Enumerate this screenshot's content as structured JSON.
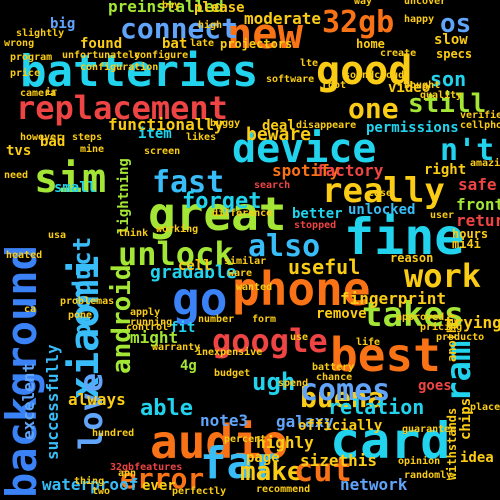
{
  "words": [
    {
      "text": "batteries",
      "color": "#22d3ee"
    },
    {
      "text": "new",
      "color": "#f97316"
    },
    {
      "text": "good",
      "color": "#facc15"
    },
    {
      "text": "32gb",
      "color": "#f97316"
    },
    {
      "text": "os",
      "color": "#60a5fa"
    },
    {
      "text": "replacement",
      "color": "#ef4444"
    },
    {
      "text": "device",
      "color": "#22d3ee"
    },
    {
      "text": "connect",
      "color": "#60a5fa"
    },
    {
      "text": "sim",
      "color": "#a3e635"
    },
    {
      "text": "fast",
      "color": "#38bdf8"
    },
    {
      "text": "n't",
      "color": "#22d3ee"
    },
    {
      "text": "one",
      "color": "#facc15"
    },
    {
      "text": "still",
      "color": "#a3e635"
    },
    {
      "text": "son",
      "color": "#22d3ee"
    },
    {
      "text": "great",
      "color": "#a3e635"
    },
    {
      "text": "really",
      "color": "#facc15"
    },
    {
      "text": "fine",
      "color": "#22d3ee"
    },
    {
      "text": "background",
      "color": "#3b82f6"
    },
    {
      "text": "xiaomi",
      "color": "#38bdf8"
    },
    {
      "text": "unlock",
      "color": "#a3e635"
    },
    {
      "text": "also",
      "color": "#38bdf8"
    },
    {
      "text": "work",
      "color": "#facc15"
    },
    {
      "text": "go",
      "color": "#3b82f6"
    },
    {
      "text": "phone",
      "color": "#f97316"
    },
    {
      "text": "google",
      "color": "#ef4444"
    },
    {
      "text": "takes",
      "color": "#a3e635"
    },
    {
      "text": "best",
      "color": "#f97316"
    },
    {
      "text": "buena",
      "color": "#facc15"
    },
    {
      "text": "android",
      "color": "#a3e635"
    },
    {
      "text": "ugh",
      "color": "#22d3ee"
    },
    {
      "text": "comes",
      "color": "#60a5fa"
    },
    {
      "text": "ram",
      "color": "#22d3ee"
    },
    {
      "text": "love",
      "color": "#60a5fa"
    },
    {
      "text": "audio",
      "color": "#f97316"
    },
    {
      "text": "card",
      "color": "#22d3ee"
    },
    {
      "text": "far",
      "color": "#38bdf8"
    },
    {
      "text": "error",
      "color": "#f97316"
    },
    {
      "text": "make",
      "color": "#facc15"
    },
    {
      "text": "cut",
      "color": "#f97316"
    },
    {
      "text": "product",
      "color": "#38bdf8"
    },
    {
      "text": "forget",
      "color": "#22d3ee"
    },
    {
      "text": "beware",
      "color": "#facc15"
    },
    {
      "text": "useful",
      "color": "#facc15"
    },
    {
      "text": "relation",
      "color": "#22d3ee"
    },
    {
      "text": "able",
      "color": "#22d3ee"
    },
    {
      "text": "note3",
      "color": "#60a5fa"
    },
    {
      "text": "galaxy",
      "color": "#60a5fa"
    },
    {
      "text": "highly",
      "color": "#facc15"
    },
    {
      "text": "sizethis",
      "color": "#facc15"
    },
    {
      "text": "network",
      "color": "#60a5fa"
    },
    {
      "text": "waterproof",
      "color": "#38bdf8"
    },
    {
      "text": "successfully",
      "color": "#38bdf8"
    },
    {
      "text": "excelent",
      "color": "#60a5fa"
    },
    {
      "text": "functionally",
      "color": "#facc15"
    },
    {
      "text": "preinstalled",
      "color": "#a3e635"
    },
    {
      "text": "spotify",
      "color": "#f97316"
    },
    {
      "text": "factory",
      "color": "#ef4444"
    },
    {
      "text": "gradable",
      "color": "#22d3ee"
    },
    {
      "text": "might",
      "color": "#a3e635"
    },
    {
      "text": "always",
      "color": "#facc15"
    },
    {
      "text": "safe",
      "color": "#ef4444"
    },
    {
      "text": "front",
      "color": "#a3e635"
    },
    {
      "text": "return",
      "color": "#ef4444"
    },
    {
      "text": "trying",
      "color": "#facc15"
    },
    {
      "text": "fingerprint",
      "color": "#facc15"
    },
    {
      "text": "remove",
      "color": "#facc15"
    },
    {
      "text": "goes",
      "color": "#ef4444"
    },
    {
      "text": "chips",
      "color": "#facc15"
    },
    {
      "text": "idea",
      "color": "#facc15"
    },
    {
      "text": "ever",
      "color": "#facc15"
    },
    {
      "text": "page",
      "color": "#facc15"
    },
    {
      "text": "officially",
      "color": "#facc15"
    },
    {
      "text": "moderate",
      "color": "#facc15"
    },
    {
      "text": "please",
      "color": "#facc15"
    },
    {
      "text": "slow",
      "color": "#facc15"
    },
    {
      "text": "video",
      "color": "#facc15"
    },
    {
      "text": "permissions",
      "color": "#22d3ee"
    },
    {
      "text": "deal",
      "color": "#facc15"
    },
    {
      "text": "better",
      "color": "#22d3ee"
    },
    {
      "text": "unlocked",
      "color": "#38bdf8"
    },
    {
      "text": "right",
      "color": "#facc15"
    },
    {
      "text": "small",
      "color": "#22d3ee"
    },
    {
      "text": "bad",
      "color": "#facc15"
    },
    {
      "text": "item",
      "color": "#22d3ee"
    },
    {
      "text": "lightning",
      "color": "#a3e635"
    },
    {
      "text": "cell",
      "color": "#facc15"
    },
    {
      "text": "fit",
      "color": "#22d3ee"
    },
    {
      "text": "4g",
      "color": "#a3e635"
    },
    {
      "text": "big",
      "color": "#60a5fa"
    },
    {
      "text": "found",
      "color": "#facc15"
    },
    {
      "text": "bat",
      "color": "#facc15"
    },
    {
      "text": "projectors",
      "color": "#facc15"
    },
    {
      "text": "home",
      "color": "#facc15"
    },
    {
      "text": "tvs",
      "color": "#facc15"
    },
    {
      "text": "uncover",
      "color": "#facc15"
    },
    {
      "text": "specs",
      "color": "#facc15"
    },
    {
      "text": "hours",
      "color": "#facc15"
    },
    {
      "text": "mi4i",
      "color": "#facc15"
    },
    {
      "text": "reason",
      "color": "#facc15"
    },
    {
      "text": "difference",
      "color": "#facc15"
    },
    {
      "text": "32gbfeatures",
      "color": "#ef4444"
    },
    {
      "text": "apn",
      "color": "#facc15"
    },
    {
      "text": "two",
      "color": "#facc15"
    },
    {
      "text": "perfectly",
      "color": "#facc15"
    },
    {
      "text": "recommend",
      "color": "#facc15"
    },
    {
      "text": "thing",
      "color": "#facc15"
    },
    {
      "text": "hundred",
      "color": "#facc15"
    },
    {
      "text": "apply",
      "color": "#facc15"
    },
    {
      "text": "running",
      "color": "#facc15"
    },
    {
      "text": "number",
      "color": "#facc15"
    },
    {
      "text": "form",
      "color": "#facc15"
    },
    {
      "text": "use",
      "color": "#facc15"
    },
    {
      "text": "inexpensive",
      "color": "#facc15"
    },
    {
      "text": "warranty",
      "color": "#facc15"
    },
    {
      "text": "chance",
      "color": "#facc15"
    },
    {
      "text": "battery",
      "color": "#facc15"
    },
    {
      "text": "life",
      "color": "#facc15"
    },
    {
      "text": "wanted",
      "color": "#facc15"
    },
    {
      "text": "approved",
      "color": "#facc15"
    },
    {
      "text": "pricing",
      "color": "#facc15"
    },
    {
      "text": "producto",
      "color": "#facc15"
    },
    {
      "text": "another",
      "color": "#facc15"
    },
    {
      "text": "stopped",
      "color": "#ef4444"
    },
    {
      "text": "cellphone",
      "color": "#facc15"
    },
    {
      "text": "verified",
      "color": "#facc15"
    },
    {
      "text": "bought",
      "color": "#facc15"
    },
    {
      "text": "quality",
      "color": "#facc15"
    },
    {
      "text": "soundcloud",
      "color": "#facc15"
    },
    {
      "text": "software",
      "color": "#facc15"
    },
    {
      "text": "lte",
      "color": "#facc15"
    },
    {
      "text": "unfortunately",
      "color": "#facc15"
    },
    {
      "text": "configure",
      "color": "#facc15"
    },
    {
      "text": "configuration",
      "color": "#facc15"
    },
    {
      "text": "however",
      "color": "#facc15"
    },
    {
      "text": "camera",
      "color": "#facc15"
    },
    {
      "text": "likes",
      "color": "#facc15"
    },
    {
      "text": "buggy",
      "color": "#facc15"
    },
    {
      "text": "screen",
      "color": "#facc15"
    },
    {
      "text": "think",
      "color": "#facc15"
    },
    {
      "text": "working",
      "color": "#facc15"
    },
    {
      "text": "similar",
      "color": "#facc15"
    },
    {
      "text": "ware",
      "color": "#facc15"
    },
    {
      "text": "randomly",
      "color": "#facc15"
    },
    {
      "text": "withstands",
      "color": "#facc15"
    },
    {
      "text": "place",
      "color": "#facc15"
    },
    {
      "text": "heated",
      "color": "#facc15"
    },
    {
      "text": "usa",
      "color": "#facc15"
    },
    {
      "text": "need",
      "color": "#facc15"
    },
    {
      "text": "buy",
      "color": "#facc15"
    },
    {
      "text": "happy",
      "color": "#facc15"
    },
    {
      "text": "create",
      "color": "#facc15"
    },
    {
      "text": "disappeare",
      "color": "#facc15"
    },
    {
      "text": "search",
      "color": "#ef4444"
    },
    {
      "text": "opinion",
      "color": "#facc15"
    },
    {
      "text": "guarantee",
      "color": "#facc15"
    },
    {
      "text": "problemas",
      "color": "#facc15"
    },
    {
      "text": "ca",
      "color": "#facc15"
    },
    {
      "text": "pone",
      "color": "#facc15"
    },
    {
      "text": "budget",
      "color": "#facc15"
    },
    {
      "text": "control",
      "color": "#facc15"
    },
    {
      "text": "spend",
      "color": "#facc15"
    },
    {
      "text": "percent",
      "color": "#facc15"
    },
    {
      "text": "amazing",
      "color": "#facc15"
    },
    {
      "text": "way",
      "color": "#facc15"
    },
    {
      "text": "steps",
      "color": "#facc15"
    },
    {
      "text": "mine",
      "color": "#facc15"
    },
    {
      "text": "late",
      "color": "#facc15"
    },
    {
      "text": "slightly",
      "color": "#facc15"
    },
    {
      "text": "wrong",
      "color": "#facc15"
    },
    {
      "text": "program",
      "color": "#facc15"
    },
    {
      "text": "price",
      "color": "#facc15"
    },
    {
      "text": "high",
      "color": "#facc15"
    },
    {
      "text": "root",
      "color": "#facc15"
    },
    {
      "text": "case",
      "color": "#facc15"
    },
    {
      "text": "user",
      "color": "#facc15"
    },
    {
      "text": "ir",
      "color": "#facc15"
    }
  ]
}
